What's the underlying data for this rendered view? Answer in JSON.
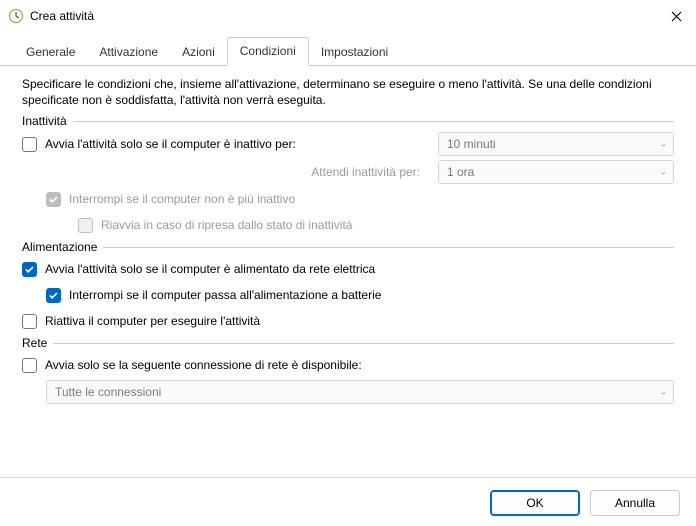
{
  "window": {
    "title": "Crea attività"
  },
  "tabs": {
    "general": "Generale",
    "triggers": "Attivazione",
    "actions": "Azioni",
    "conditions": "Condizioni",
    "settings": "Impostazioni",
    "active": "conditions"
  },
  "conditions": {
    "description": "Specificare le condizioni che, insieme all'attivazione, determinano se eseguire o meno l'attività. Se una delle condizioni specificate non è soddisfatta, l'attività non verrà eseguita.",
    "idle": {
      "group": "Inattività",
      "start_if_idle": {
        "label": "Avvia l'attività solo se il computer è inattivo per:",
        "checked": false
      },
      "idle_duration": "10 minuti",
      "wait_label": "Attendi inattività per:",
      "wait_duration": "1 ora",
      "stop_if_not_idle": {
        "label": "Interrompi se il computer non è più inattivo",
        "checked": true
      },
      "restart_if_idle": {
        "label": "Riavvia in caso di ripresa dallo stato di inattività",
        "checked": false
      }
    },
    "power": {
      "group": "Alimentazione",
      "start_on_ac": {
        "label": "Avvia l'attività solo se il computer è alimentato da rete elettrica",
        "checked": true
      },
      "stop_on_battery": {
        "label": "Interrompi se il computer passa all'alimentazione a batterie",
        "checked": true
      },
      "wake": {
        "label": "Riattiva il computer per eseguire l'attività",
        "checked": false
      }
    },
    "network": {
      "group": "Rete",
      "start_if_network": {
        "label": "Avvia solo se la seguente connessione di rete è disponibile:",
        "checked": false
      },
      "connection": "Tutte le connessioni"
    }
  },
  "buttons": {
    "ok": "OK",
    "cancel": "Annulla"
  }
}
